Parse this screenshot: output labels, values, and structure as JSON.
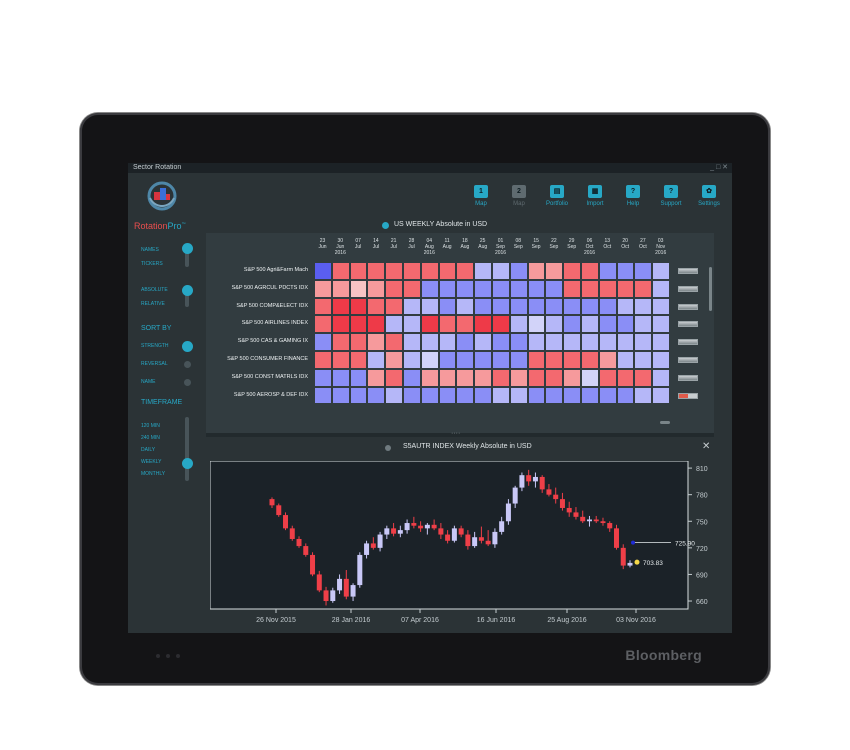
{
  "window": {
    "title": "Sector Rotation",
    "controls": "_ □ ✕"
  },
  "device": {
    "brand": "Bloomberg"
  },
  "app": {
    "brand_main": "Rotation",
    "brand_suffix": "Pro",
    "brand_mark": "™"
  },
  "toolbar": [
    {
      "icon": "1",
      "label": "Map",
      "active": true
    },
    {
      "icon": "2",
      "label": "Map",
      "active": false
    },
    {
      "icon": "portfolio-icon",
      "label": "Portfolio",
      "active": true
    },
    {
      "icon": "import-icon",
      "label": "Import",
      "active": true
    },
    {
      "icon": "help-icon",
      "label": "Help",
      "active": true
    },
    {
      "icon": "support-icon",
      "label": "Support",
      "active": true
    },
    {
      "icon": "settings-icon",
      "label": "Settings",
      "active": true
    }
  ],
  "sidebar": {
    "names": "NAMES",
    "tickers": "TICKERS",
    "absolute": "ABSOLUTE",
    "relative": "RELATIVE",
    "sort_by": "SORT BY",
    "strength": "STRENGTH",
    "reversal": "REVERSAL",
    "name": "NAME",
    "timeframe": "TIMEFRAME",
    "tf_options": [
      "120 MIN",
      "240 MIN",
      "DAILY",
      "WEEKLY",
      "MONTHLY"
    ],
    "tf_selected": "WEEKLY"
  },
  "heatmap": {
    "title": "US WEEKLY Absolute  in USD",
    "dates": [
      [
        "23",
        "Jun",
        ""
      ],
      [
        "30",
        "Jun",
        "2016"
      ],
      [
        "07",
        "Jul",
        ""
      ],
      [
        "14",
        "Jul",
        ""
      ],
      [
        "21",
        "Jul",
        ""
      ],
      [
        "28",
        "Jul",
        ""
      ],
      [
        "04",
        "Aug",
        "2016"
      ],
      [
        "11",
        "Aug",
        ""
      ],
      [
        "18",
        "Aug",
        ""
      ],
      [
        "25",
        "Aug",
        ""
      ],
      [
        "01",
        "Sep",
        "2016"
      ],
      [
        "08",
        "Sep",
        ""
      ],
      [
        "15",
        "Sep",
        ""
      ],
      [
        "22",
        "Sep",
        ""
      ],
      [
        "29",
        "Sep",
        ""
      ],
      [
        "06",
        "Oct",
        "2016"
      ],
      [
        "13",
        "Oct",
        ""
      ],
      [
        "20",
        "Oct",
        ""
      ],
      [
        "27",
        "Oct",
        ""
      ],
      [
        "03",
        "Nov",
        "2016"
      ]
    ],
    "rows": [
      "S&P 500 Agri&Farm Mach",
      "S&P 500 AGRCUL PDCTS IDX",
      "S&P 500 COMP&ELECT IDX",
      "S&P 500 AIRLINES INDEX",
      "S&P 500 CAS & GAMING IX",
      "S&P 500 CONSUMER FINANCE",
      "S&P 500 CONST MATRLS IDX",
      "S&P 500 AEROSP & DEF IDX"
    ],
    "colors": {
      "dr": "#ee3a48",
      "r": "#f3696f",
      "lr": "#f69a9c",
      "pr": "#f7c3c4",
      "db": "#5a5ef0",
      "b": "#8a8ef6",
      "lb": "#b5b7f8",
      "pb": "#d2d3f9"
    },
    "cells": [
      [
        "db",
        "r",
        "r",
        "r",
        "r",
        "r",
        "r",
        "r",
        "r",
        "lb",
        "lb",
        "b",
        "lr",
        "lr",
        "r",
        "r",
        "b",
        "b",
        "b",
        "lb"
      ],
      [
        "lr",
        "lr",
        "pr",
        "lr",
        "r",
        "r",
        "b",
        "b",
        "b",
        "b",
        "b",
        "b",
        "b",
        "b",
        "r",
        "r",
        "r",
        "r",
        "r",
        "lb"
      ],
      [
        "r",
        "dr",
        "dr",
        "r",
        "r",
        "lb",
        "lb",
        "b",
        "lb",
        "b",
        "b",
        "b",
        "b",
        "b",
        "b",
        "b",
        "b",
        "lb",
        "lb",
        "lb"
      ],
      [
        "r",
        "dr",
        "dr",
        "dr",
        "lb",
        "lb",
        "dr",
        "r",
        "r",
        "dr",
        "dr",
        "lb",
        "pb",
        "lb",
        "b",
        "lb",
        "b",
        "b",
        "lb",
        "lb"
      ],
      [
        "b",
        "r",
        "r",
        "lr",
        "r",
        "lb",
        "lb",
        "lb",
        "b",
        "lb",
        "b",
        "b",
        "lb",
        "lb",
        "lb",
        "lb",
        "lb",
        "lb",
        "lb",
        "lb"
      ],
      [
        "r",
        "r",
        "r",
        "lb",
        "lr",
        "lb",
        "pb",
        "b",
        "b",
        "b",
        "b",
        "b",
        "r",
        "r",
        "r",
        "r",
        "lr",
        "lb",
        "lb",
        "lb"
      ],
      [
        "b",
        "b",
        "b",
        "lr",
        "r",
        "b",
        "lr",
        "lr",
        "lr",
        "lr",
        "r",
        "lr",
        "r",
        "r",
        "lr",
        "pb",
        "r",
        "r",
        "r",
        "lb"
      ],
      [
        "b",
        "b",
        "b",
        "b",
        "lb",
        "b",
        "b",
        "b",
        "b",
        "b",
        "lb",
        "lb",
        "b",
        "b",
        "b",
        "b",
        "b",
        "b",
        "lb",
        "lb"
      ]
    ]
  },
  "chart_data": {
    "type": "candlestick",
    "title": "S5AUTR INDEX Weekly Absolute  in USD",
    "x_ticks": [
      "26 Nov 2015",
      "28 Jan 2016",
      "07 Apr 2016",
      "16 Jun 2016",
      "25 Aug 2016",
      "03 Nov 2016"
    ],
    "y_ticks": [
      810,
      780,
      750,
      720,
      690,
      660
    ],
    "ylim": [
      651,
      818
    ],
    "markers": [
      {
        "label": "725.90",
        "value": 725.9,
        "color": "#1f2bd6"
      },
      {
        "label": "703.83",
        "value": 703.83,
        "color": "#f5d84a"
      }
    ],
    "candles": [
      [
        775,
        777,
        765,
        768
      ],
      [
        768,
        770,
        755,
        757
      ],
      [
        757,
        760,
        740,
        742
      ],
      [
        742,
        745,
        728,
        730
      ],
      [
        730,
        733,
        720,
        722
      ],
      [
        722,
        725,
        710,
        712
      ],
      [
        712,
        715,
        688,
        690
      ],
      [
        690,
        694,
        670,
        672
      ],
      [
        672,
        676,
        655,
        660
      ],
      [
        660,
        675,
        658,
        672
      ],
      [
        672,
        690,
        668,
        685
      ],
      [
        685,
        695,
        662,
        665
      ],
      [
        665,
        680,
        660,
        678
      ],
      [
        678,
        715,
        675,
        712
      ],
      [
        712,
        728,
        708,
        725
      ],
      [
        725,
        732,
        718,
        720
      ],
      [
        720,
        738,
        716,
        735
      ],
      [
        735,
        745,
        730,
        742
      ],
      [
        742,
        748,
        733,
        736
      ],
      [
        736,
        745,
        732,
        740
      ],
      [
        740,
        752,
        736,
        748
      ],
      [
        748,
        755,
        742,
        745
      ],
      [
        745,
        750,
        738,
        742
      ],
      [
        742,
        748,
        735,
        746
      ],
      [
        746,
        752,
        740,
        742
      ],
      [
        742,
        748,
        730,
        735
      ],
      [
        735,
        740,
        725,
        728
      ],
      [
        728,
        745,
        726,
        742
      ],
      [
        742,
        745,
        732,
        735
      ],
      [
        735,
        740,
        718,
        722
      ],
      [
        722,
        738,
        720,
        732
      ],
      [
        732,
        744,
        725,
        728
      ],
      [
        728,
        740,
        722,
        724
      ],
      [
        724,
        742,
        720,
        738
      ],
      [
        738,
        755,
        735,
        750
      ],
      [
        750,
        775,
        746,
        770
      ],
      [
        770,
        790,
        765,
        788
      ],
      [
        788,
        805,
        784,
        802
      ],
      [
        802,
        808,
        790,
        795
      ],
      [
        795,
        805,
        788,
        800
      ],
      [
        800,
        802,
        782,
        786
      ],
      [
        786,
        792,
        778,
        780
      ],
      [
        780,
        788,
        770,
        775
      ],
      [
        775,
        782,
        762,
        765
      ],
      [
        765,
        772,
        755,
        760
      ],
      [
        760,
        766,
        752,
        755
      ],
      [
        755,
        762,
        748,
        750
      ],
      [
        750,
        756,
        744,
        752
      ],
      [
        752,
        756,
        748,
        750
      ],
      [
        750,
        754,
        745,
        748
      ],
      [
        748,
        750,
        738,
        742
      ],
      [
        742,
        746,
        718,
        720
      ],
      [
        720,
        724,
        696,
        700
      ],
      [
        700,
        706,
        698,
        703
      ]
    ]
  }
}
